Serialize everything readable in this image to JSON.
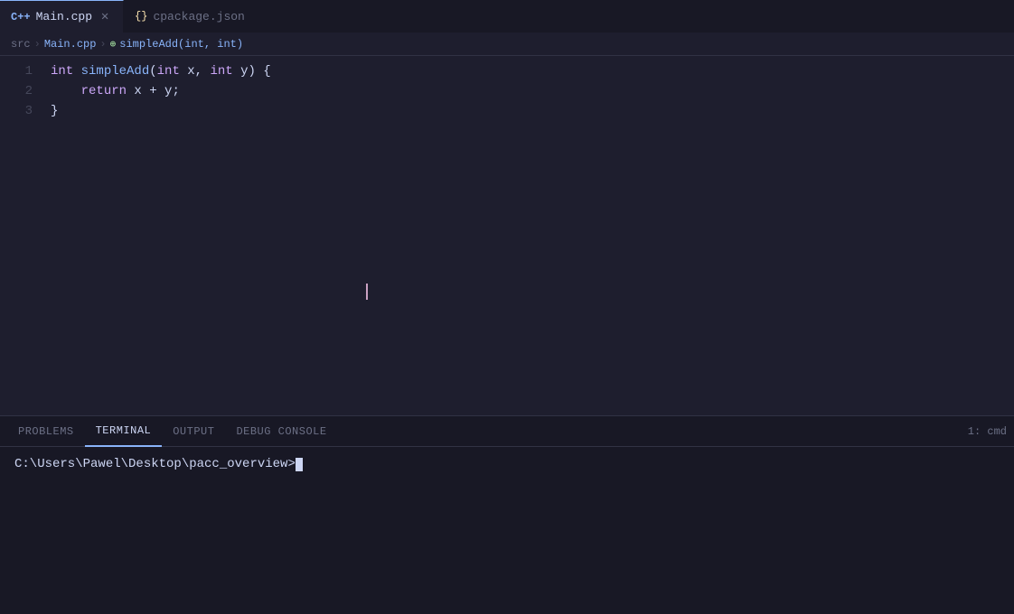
{
  "tabs": [
    {
      "id": "main-cpp",
      "label": "Main.cpp",
      "icon_type": "cpp",
      "icon_text": "C++",
      "active": true,
      "has_close": true
    },
    {
      "id": "cpackage-json",
      "label": "cpackage.json",
      "icon_type": "json",
      "icon_text": "{}",
      "active": false,
      "has_close": false
    }
  ],
  "breadcrumb": {
    "parts": [
      {
        "label": "src",
        "dim": true
      },
      {
        "label": "Main.cpp",
        "dim": false
      },
      {
        "label": "simpleAdd(int, int)",
        "dim": false,
        "is_func": true
      }
    ]
  },
  "editor": {
    "lines": [
      {
        "number": "1",
        "tokens": [
          {
            "type": "kw",
            "text": "int"
          },
          {
            "type": "plain",
            "text": " "
          },
          {
            "type": "fn",
            "text": "simpleAdd"
          },
          {
            "type": "punct",
            "text": "("
          },
          {
            "type": "kw",
            "text": "int"
          },
          {
            "type": "plain",
            "text": " x, "
          },
          {
            "type": "kw",
            "text": "int"
          },
          {
            "type": "plain",
            "text": " y) {"
          }
        ]
      },
      {
        "number": "2",
        "tokens": [
          {
            "type": "plain",
            "text": "    "
          },
          {
            "type": "kw",
            "text": "return"
          },
          {
            "type": "plain",
            "text": " x + y;"
          }
        ]
      },
      {
        "number": "3",
        "tokens": [
          {
            "type": "plain",
            "text": "}"
          }
        ]
      }
    ]
  },
  "panel": {
    "tabs": [
      {
        "label": "PROBLEMS",
        "active": false
      },
      {
        "label": "TERMINAL",
        "active": true
      },
      {
        "label": "OUTPUT",
        "active": false
      },
      {
        "label": "DEBUG CONSOLE",
        "active": false
      }
    ],
    "terminal_badge": "1: cmd",
    "terminal_prompt": "C:\\Users\\Pawel\\Desktop\\pacc_overview>"
  }
}
